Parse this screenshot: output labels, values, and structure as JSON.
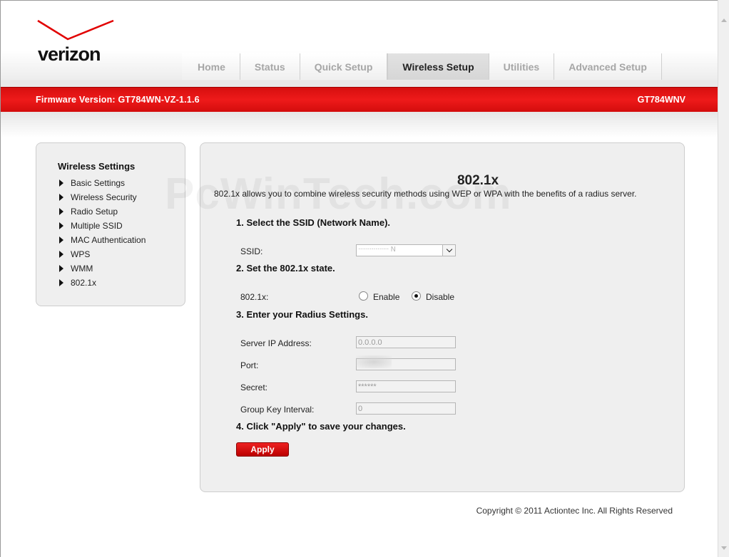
{
  "brand": {
    "logo_text": "verizon",
    "logo_icon": "verizon-check-mark",
    "accent_color": "#e10000"
  },
  "tabs": [
    {
      "label": "Home",
      "active": false
    },
    {
      "label": "Status",
      "active": false
    },
    {
      "label": "Quick Setup",
      "active": false
    },
    {
      "label": "Wireless Setup",
      "active": true
    },
    {
      "label": "Utilities",
      "active": false
    },
    {
      "label": "Advanced Setup",
      "active": false
    }
  ],
  "banner": {
    "firmware": "Firmware Version: GT784WN-VZ-1.1.6",
    "model": "GT784WNV"
  },
  "sidebar": {
    "title": "Wireless Settings",
    "items": [
      {
        "label": "Basic Settings"
      },
      {
        "label": "Wireless Security"
      },
      {
        "label": "Radio Setup"
      },
      {
        "label": "Multiple SSID"
      },
      {
        "label": "MAC Authentication"
      },
      {
        "label": "WPS"
      },
      {
        "label": "WMM"
      },
      {
        "label": "802.1x"
      }
    ]
  },
  "main": {
    "watermark": "PcWinTech.com",
    "title": "802.1x",
    "intro": "802.1x allows you to combine wireless security methods using WEP or WPA with the benefits of a radius server.",
    "step1": "1. Select the SSID (Network Name).",
    "ssid_label": "SSID:",
    "ssid_value": "················ N",
    "step2": "2. Set the 802.1x state.",
    "state_label": "802.1x:",
    "enable_label": "Enable",
    "disable_label": "Disable",
    "state_value": "Disable",
    "step3": "3. Enter your Radius Settings.",
    "server_ip_label": "Server IP Address:",
    "server_ip_value": "0.0.0.0",
    "port_label": "Port:",
    "port_value": "",
    "secret_label": "Secret:",
    "secret_value": "******",
    "group_key_label": "Group Key Interval:",
    "group_key_value": "0",
    "step4": "4. Click \"Apply\" to save your changes.",
    "apply_label": "Apply"
  },
  "footer": {
    "copyright": "Copyright © 2011 Actiontec Inc. All Rights Reserved"
  }
}
